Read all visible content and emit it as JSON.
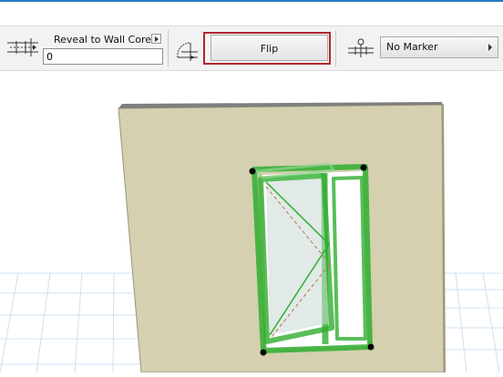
{
  "toolbar": {
    "reveal_label": "Reveal to Wall Core",
    "reveal_value": "0",
    "flip_label": "Flip",
    "marker_label": "No Marker",
    "icons": [
      "reveal-icon",
      "flip-side-icon",
      "marker-icon",
      "dropdown-arrow-icon"
    ]
  },
  "colors": {
    "toolbar_bg": "#f2f2f2",
    "highlight": "#b0282b",
    "wall": "#d4d0b0",
    "window_green": "#2fae2f",
    "grid": "#cfe0f2"
  }
}
